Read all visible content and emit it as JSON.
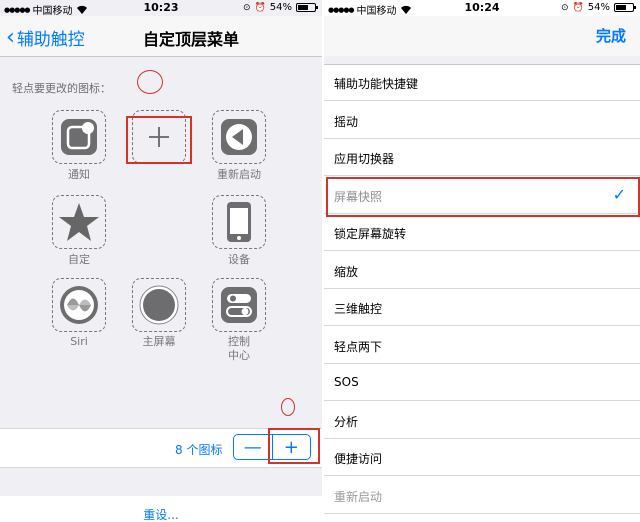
{
  "left": {
    "status": {
      "carrier": "中国移动",
      "time": "10:23",
      "battery": "54%",
      "battery_level": 0.54
    },
    "nav": {
      "back": "辅助触控",
      "title": "自定顶层菜单"
    },
    "hint": "轻点要更改的图标：",
    "icons": [
      {
        "label": "通知",
        "icon": "notification-icon"
      },
      {
        "label": "",
        "icon": "add-icon"
      },
      {
        "label": "重新启动",
        "icon": "restart-icon"
      },
      {
        "label": "自定",
        "icon": "star-icon"
      },
      {
        "label": "设备",
        "icon": "device-icon"
      },
      {
        "label": "Siri",
        "icon": "siri-icon"
      },
      {
        "label": "主屏幕",
        "icon": "home-icon"
      },
      {
        "label": "控制\n中心",
        "icon": "control-center-icon"
      }
    ],
    "count": "8 个图标",
    "stepper": {
      "minus": "—",
      "plus": "+"
    },
    "reset": "重设..."
  },
  "right": {
    "status": {
      "carrier": "中国移动",
      "time": "10:24",
      "battery": "54%",
      "battery_level": 0.54
    },
    "nav": {
      "done": "完成"
    },
    "items": [
      {
        "label": "辅助功能快捷键"
      },
      {
        "label": "摇动"
      },
      {
        "label": "应用切换器"
      },
      {
        "label": "屏幕快照",
        "checked": true
      },
      {
        "label": "锁定屏幕旋转"
      },
      {
        "label": "缩放"
      },
      {
        "label": "三维触控"
      },
      {
        "label": "轻点两下"
      },
      {
        "label": "SOS"
      },
      {
        "label": "分析"
      },
      {
        "label": "便捷访问"
      },
      {
        "label": "重新启动"
      }
    ],
    "check_glyph": "✓"
  },
  "colors": {
    "accent": "#007aff",
    "annotation": "#d0342c",
    "background": "#efeff4"
  }
}
